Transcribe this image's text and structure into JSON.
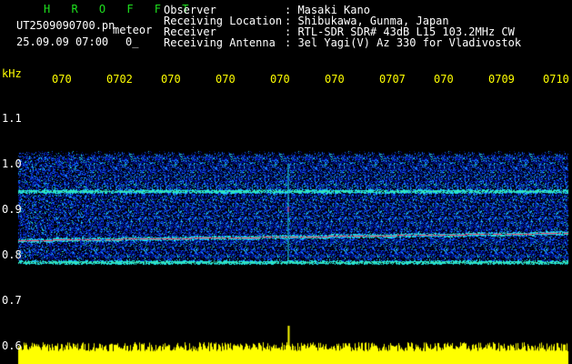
{
  "header": {
    "app_title": "H R O F F T",
    "file_name": "UT2509090700.pn",
    "mode_label": "meteor",
    "date_time": "25.09.09 07:00",
    "counter": "0_"
  },
  "station": {
    "observer_label": "Observer",
    "observer_value": ": Masaki Kano",
    "location_label": "Receiving Location",
    "location_value": ": Shibukawa, Gunma, Japan",
    "receiver_label": "Receiver",
    "receiver_value": ": RTL-SDR SDR# 43dB L15 103.2MHz CW",
    "antenna_label": "Receiving Antenna",
    "antenna_value": ": 3el Yagi(V) Az 330 for Vladivostok"
  },
  "chart_data": {
    "type": "heatmap",
    "ylabel": "kHz",
    "y_ticks": [
      "1.1",
      "1.0",
      "0.9",
      "0.8",
      "0.7",
      "0.6"
    ],
    "x_ticks": [
      "070",
      "0702",
      "070",
      "070",
      "070",
      "070",
      "0707",
      "070",
      "0709",
      "0710"
    ],
    "ylim": [
      0.6,
      1.15
    ],
    "noise_band_khz": [
      0.78,
      1.03
    ],
    "carrier_lines_khz": [
      {
        "freq_start": 0.832,
        "freq_end": 0.848,
        "color": "#ff3060"
      },
      {
        "freq_start": 0.94,
        "freq_end": 0.94,
        "color": "#40e0a0"
      },
      {
        "freq_start": 0.785,
        "freq_end": 0.785,
        "color": "#40e0a0"
      }
    ],
    "meteor_spike_minute_fraction": 0.49,
    "colors": {
      "background": "#000000",
      "noise_low": "#0010a0",
      "noise_mid": "#1060ff",
      "noise_high": "#20e0e0",
      "signal": "#ff2060",
      "trace": "#ffff00"
    }
  }
}
